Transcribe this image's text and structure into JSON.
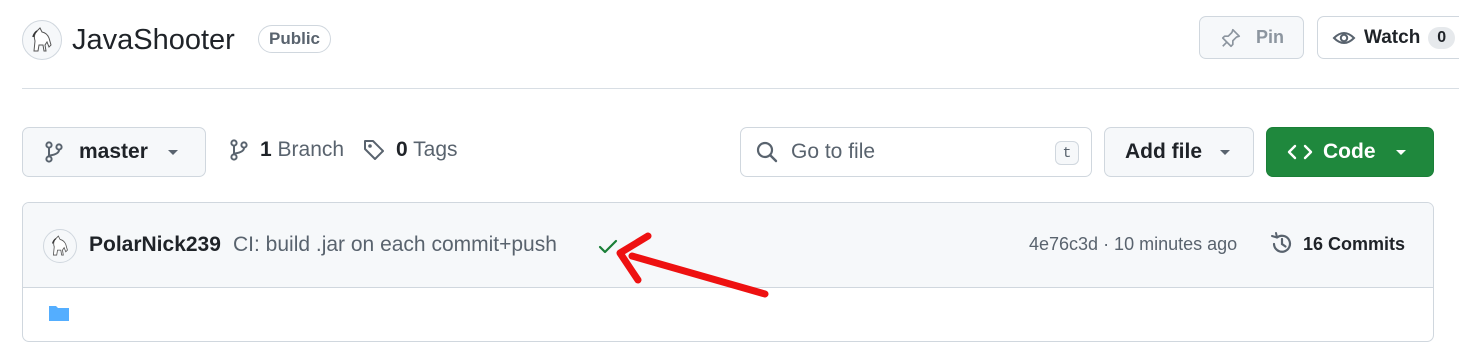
{
  "repo": {
    "name": "JavaShooter",
    "visibility": "Public",
    "owner_avatar": "horse-avatar-icon"
  },
  "header_actions": {
    "pin_label": "Pin",
    "watch_label": "Watch",
    "watch_count": "0"
  },
  "toolbar": {
    "branch_selected": "master",
    "branch_count": "1",
    "branch_label": "Branch",
    "tag_count": "0",
    "tag_label": "Tags",
    "search_placeholder": "Go to file",
    "search_shortcut": "t",
    "add_file_label": "Add file",
    "code_label": "Code"
  },
  "latest_commit": {
    "author": "PolarNick239",
    "message": "CI: build .jar on each commit+push",
    "status": "success-check-icon",
    "sha_time": "4e76c3d · 10 minutes ago",
    "commits_label": "16 Commits"
  },
  "colors": {
    "code_button": "#1f883d",
    "check": "#1a7f37",
    "annotation_arrow": "#ee1111"
  }
}
